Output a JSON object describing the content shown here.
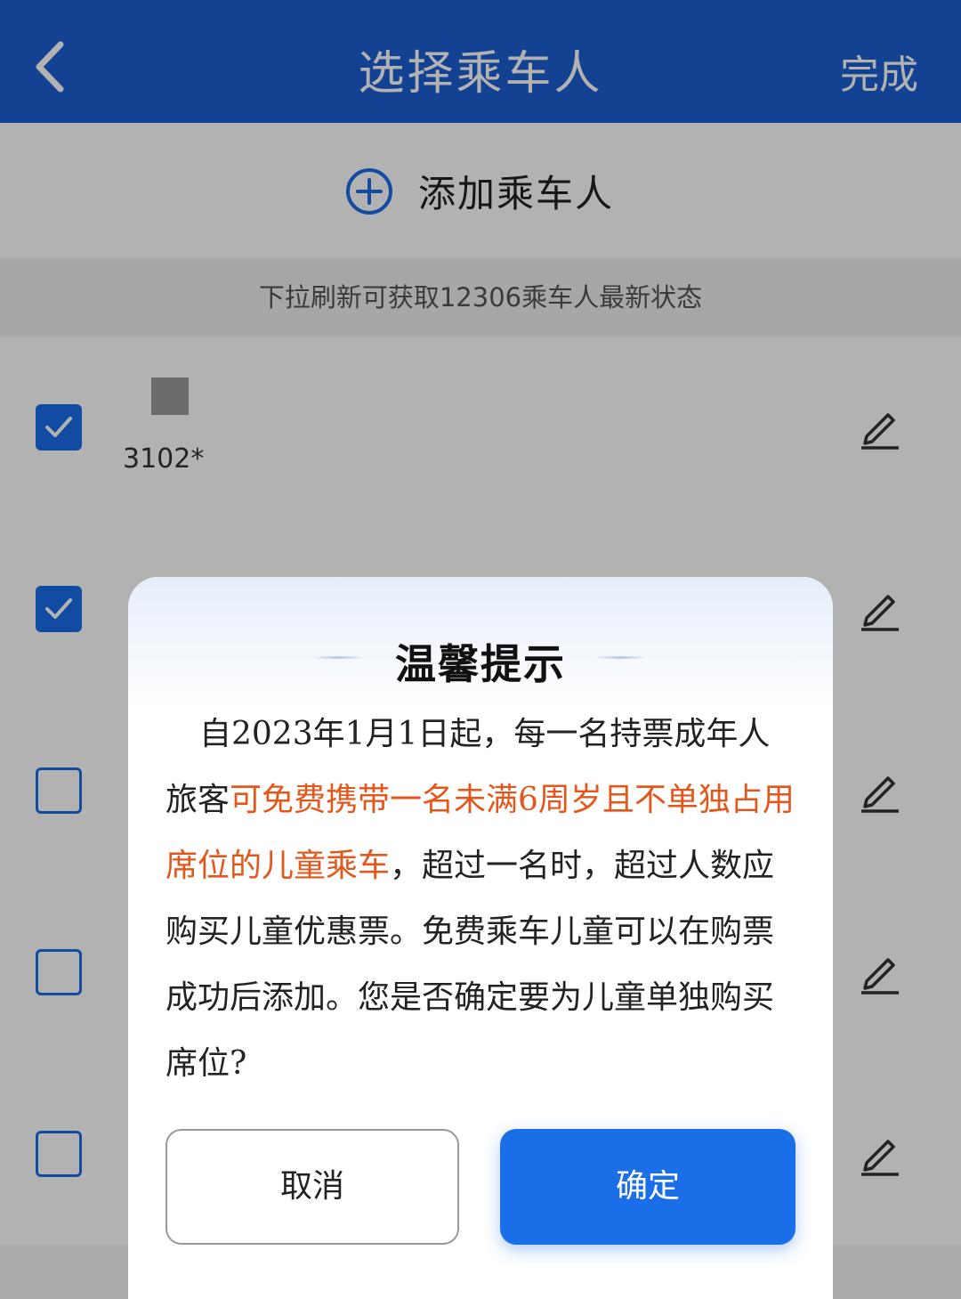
{
  "header": {
    "title": "选择乘车人",
    "done_label": "完成"
  },
  "add_passenger": {
    "label": "添加乘车人"
  },
  "tip": {
    "text": "下拉刷新可获取12306乘车人最新状态"
  },
  "passengers": [
    {
      "id_text": "3102*",
      "checked": true
    },
    {
      "id_text": "",
      "checked": true
    },
    {
      "id_text": "",
      "checked": false
    },
    {
      "id_text": "",
      "checked": false
    },
    {
      "id_text": "",
      "checked": false
    }
  ],
  "dialog": {
    "title": "温馨提示",
    "body_part1": "自2023年1月1日起，每一名持票成年人旅客",
    "body_highlight": "可免费携带一名未满6周岁且不单独占用席位的儿童乘车",
    "body_part2": "，超过一名时，超过人数应购买儿童优惠票。免费乘车儿童可以在购票成功后添加。您是否确定要为儿童单独购买席位?",
    "cancel_label": "取消",
    "confirm_label": "确定"
  },
  "colors": {
    "header_bg": "#1a5fd0",
    "accent": "#1a6ee8",
    "highlight": "#e2571c"
  }
}
